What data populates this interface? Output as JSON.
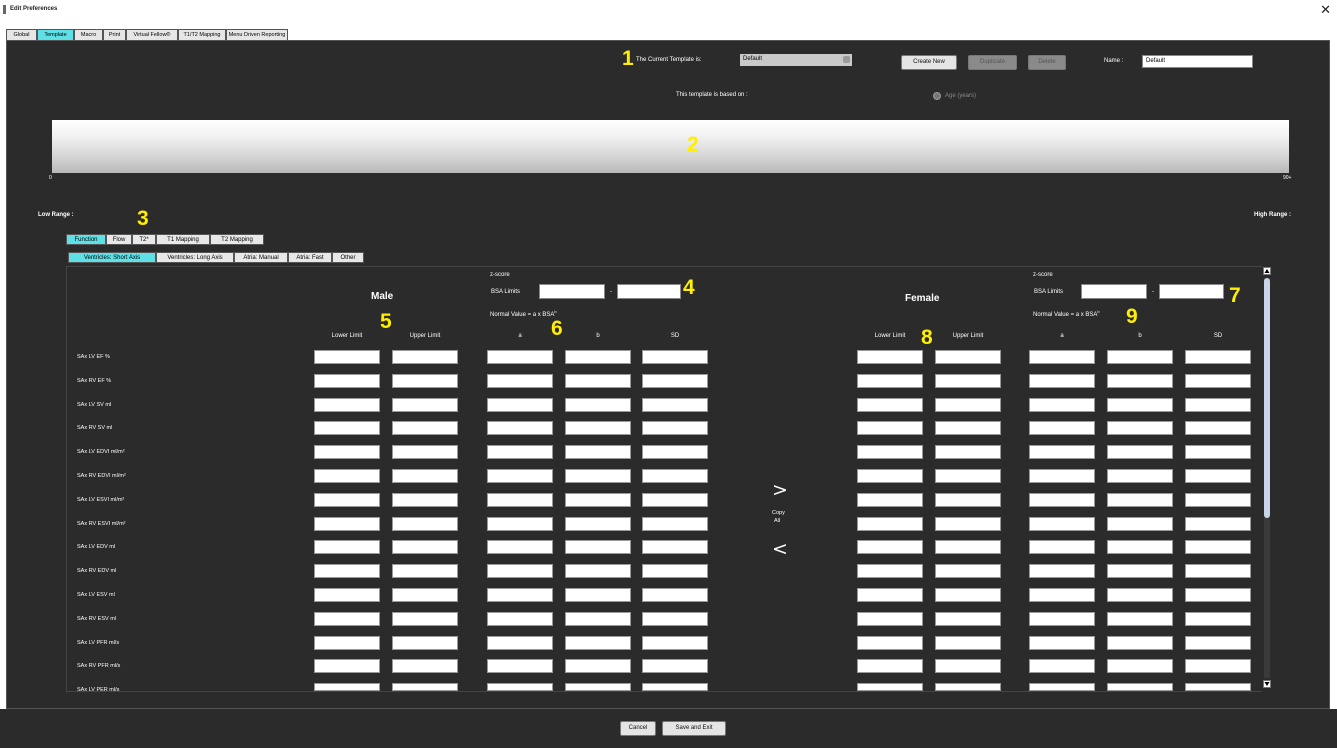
{
  "window": {
    "title": "Edit Preferences",
    "close_glyph": "✕"
  },
  "tabs": [
    {
      "label": "Global",
      "active": false
    },
    {
      "label": "Template",
      "active": true
    },
    {
      "label": "Macro",
      "active": false
    },
    {
      "label": "Print",
      "active": false
    },
    {
      "label": "Virtual Fellow®",
      "active": false
    },
    {
      "label": "T1/T2 Mapping",
      "active": false
    },
    {
      "label": "Menu Driven Reporting",
      "active": false
    }
  ],
  "header": {
    "current_template_label": "The Current Template is:",
    "current_template_value": "Default",
    "create_new_label": "Create New",
    "duplicate_label": "Duplicate",
    "delete_label": "Delete",
    "name_label": "Name :",
    "name_value": "Default",
    "based_on_label": "This template is based on :",
    "age_option_label": "Age (years)"
  },
  "range": {
    "min_label": "0",
    "max_label": "90+",
    "low_range_label": "Low Range :",
    "high_range_label": "High Range :"
  },
  "category_tabs": [
    {
      "label": "Function",
      "active": true
    },
    {
      "label": "Flow",
      "active": false
    },
    {
      "label": "T2*",
      "active": false
    },
    {
      "label": "T1 Mapping",
      "active": false
    },
    {
      "label": "T2 Mapping",
      "active": false
    }
  ],
  "sub_tabs": [
    {
      "label": "Ventricles: Short Axis",
      "active": true
    },
    {
      "label": "Ventricles: Long Axis",
      "active": false
    },
    {
      "label": "Atria: Manual",
      "active": false
    },
    {
      "label": "Atria: Fast",
      "active": false
    },
    {
      "label": "Other",
      "active": false
    }
  ],
  "male": {
    "title": "Male",
    "zscore_label": "z-score",
    "bsa_limits_label": "BSA Limits",
    "dash": "-",
    "formula_label": "Normal Value = a x BSA",
    "formula_sup": "b",
    "lower_limit_label": "Lower Limit",
    "upper_limit_label": "Upper Limit",
    "a_label": "a",
    "b_label": "b",
    "sd_label": "SD"
  },
  "female": {
    "title": "Female",
    "zscore_label": "z-score",
    "bsa_limits_label": "BSA Limits",
    "dash": "-",
    "formula_label": "Normal Value = a x BSA",
    "formula_sup": "b",
    "lower_limit_label": "Lower Limit",
    "upper_limit_label": "Upper Limit",
    "a_label": "a",
    "b_label": "b",
    "sd_label": "SD"
  },
  "copy": {
    "right_arrow": ">",
    "copy_label": "Copy",
    "all_label": "All",
    "left_arrow": "<"
  },
  "rows": [
    "SAx LV EF %",
    "SAx RV EF %",
    "SAx LV SV ml",
    "SAx RV SV ml",
    "SAx LV EDVI ml/m²",
    "SAx RV EDVI ml/m²",
    "SAx LV ESVI ml/m²",
    "SAx RV ESVI ml/m²",
    "SAx LV EDV ml",
    "SAx RV EDV ml",
    "SAx LV ESV ml",
    "SAx RV ESV ml",
    "SAx LV PFR ml/s",
    "SAx RV PFR ml/s",
    "SAx LV PER ml/s"
  ],
  "footer": {
    "cancel_label": "Cancel",
    "save_exit_label": "Save and Exit"
  },
  "callouts": [
    "1",
    "2",
    "3",
    "4",
    "5",
    "6",
    "7",
    "8",
    "9"
  ],
  "colors": {
    "accent": "#5ee0e6",
    "background": "#2b2b2b",
    "callout": "#ffee00"
  },
  "icons": {
    "scroll_up": "triangle-up-icon",
    "scroll_down": "triangle-down-icon",
    "radio": "radio-icon"
  }
}
